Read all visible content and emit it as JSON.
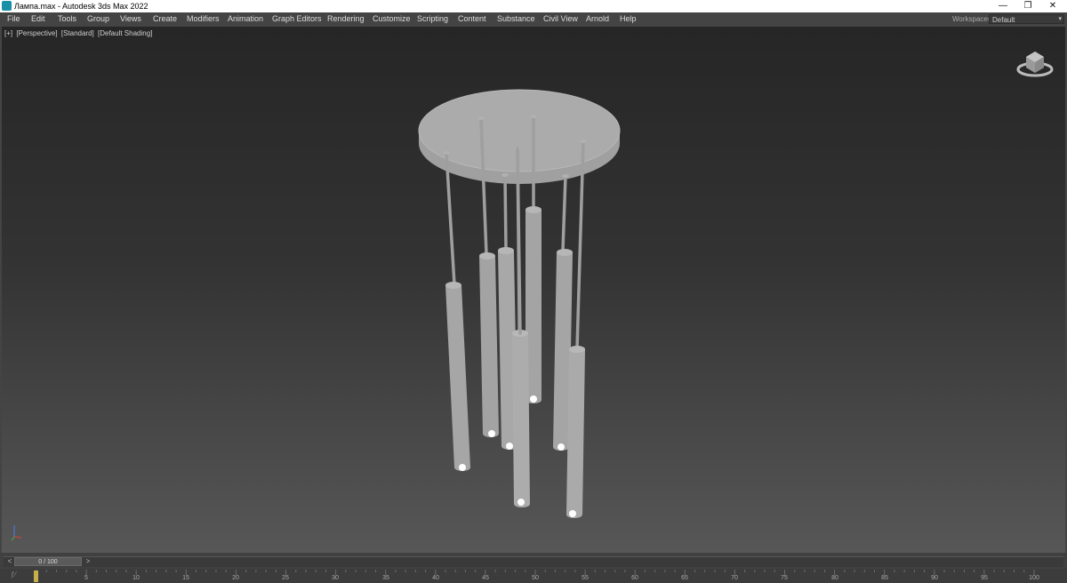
{
  "window": {
    "title": "Лампа.max - Autodesk 3ds Max 2022",
    "minimize_glyph": "—",
    "restore_glyph": "❐",
    "close_glyph": "✕"
  },
  "menu": {
    "items": [
      "File",
      "Edit",
      "Tools",
      "Group",
      "Views",
      "Create",
      "Modifiers",
      "Animation",
      "Graph Editors",
      "Rendering",
      "Customize",
      "Scripting",
      "Content",
      "Substance",
      "Civil View",
      "Arnold",
      "Help"
    ],
    "workspaces_label": "Workspaces:",
    "workspace_value": "Default"
  },
  "viewport": {
    "labels": [
      "[+]",
      "[Perspective]",
      "[Standard]",
      "[Default Shading]"
    ],
    "background_top": "#262626",
    "background_bottom": "#575757",
    "object_color": "#a9a9a9"
  },
  "timeline": {
    "frame_display": "0 / 100",
    "prev_glyph": "<",
    "next_glyph": ">",
    "ticks": [
      "5",
      "10",
      "15",
      "20",
      "25",
      "30",
      "35",
      "40",
      "45",
      "50",
      "55",
      "60",
      "65",
      "70",
      "75",
      "80",
      "85",
      "90",
      "95",
      "100"
    ],
    "marker_color": "#c6b04a"
  },
  "icons": {
    "app": "3ds-max-icon",
    "viewcube": "viewcube-icon",
    "axis": "axis-tripod-icon"
  }
}
